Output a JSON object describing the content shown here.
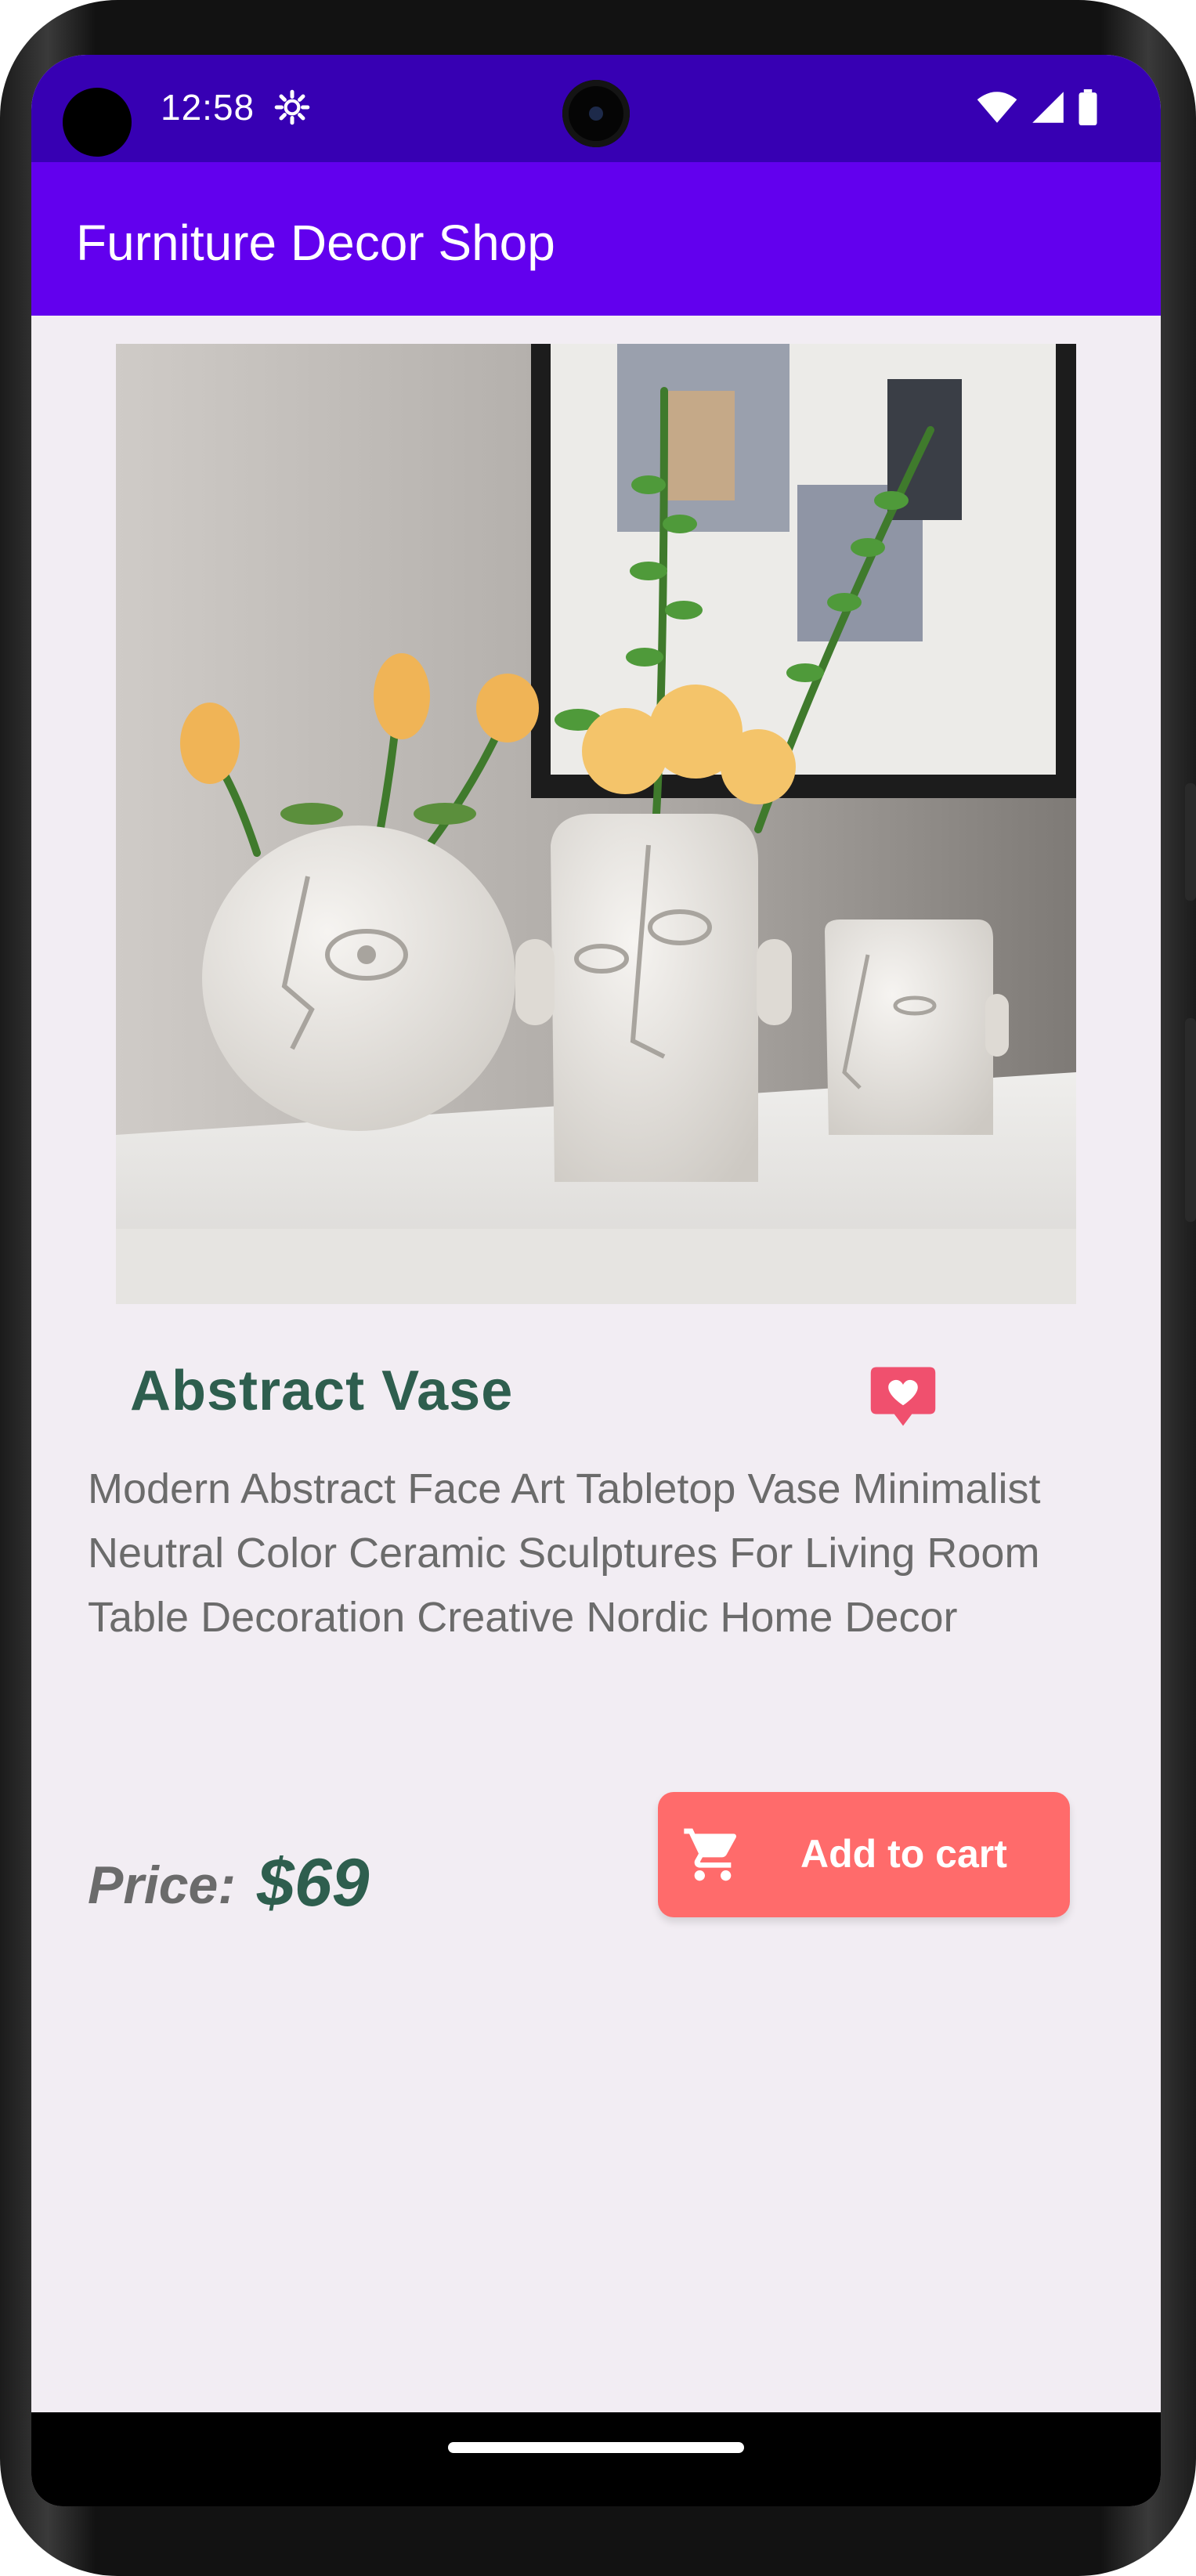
{
  "status_bar": {
    "time": "12:58",
    "icons": [
      "settings-gear-icon",
      "wifi-icon",
      "signal-icon",
      "battery-icon"
    ]
  },
  "app_bar": {
    "title": "Furniture Decor Shop",
    "color": "#6200ee"
  },
  "product": {
    "image_alt": "abstract-face-vases-photo",
    "name": "Abstract Vase",
    "description": "Modern Abstract Face Art Tabletop Vase Minimalist Neutral Color Ceramic Sculptures For Living Room Table Decoration Creative Nordic Home Decor",
    "price_label": "Price:",
    "price_value": "$69",
    "favorite_icon": "heart-chat-icon"
  },
  "actions": {
    "add_to_cart_label": "Add to cart",
    "add_to_cart_icon": "cart-icon",
    "button_color": "#ff6b6b"
  },
  "theme": {
    "status_bar_color": "#3700b3",
    "accent_green": "#2e5e4e",
    "background": "#f2edf3"
  }
}
